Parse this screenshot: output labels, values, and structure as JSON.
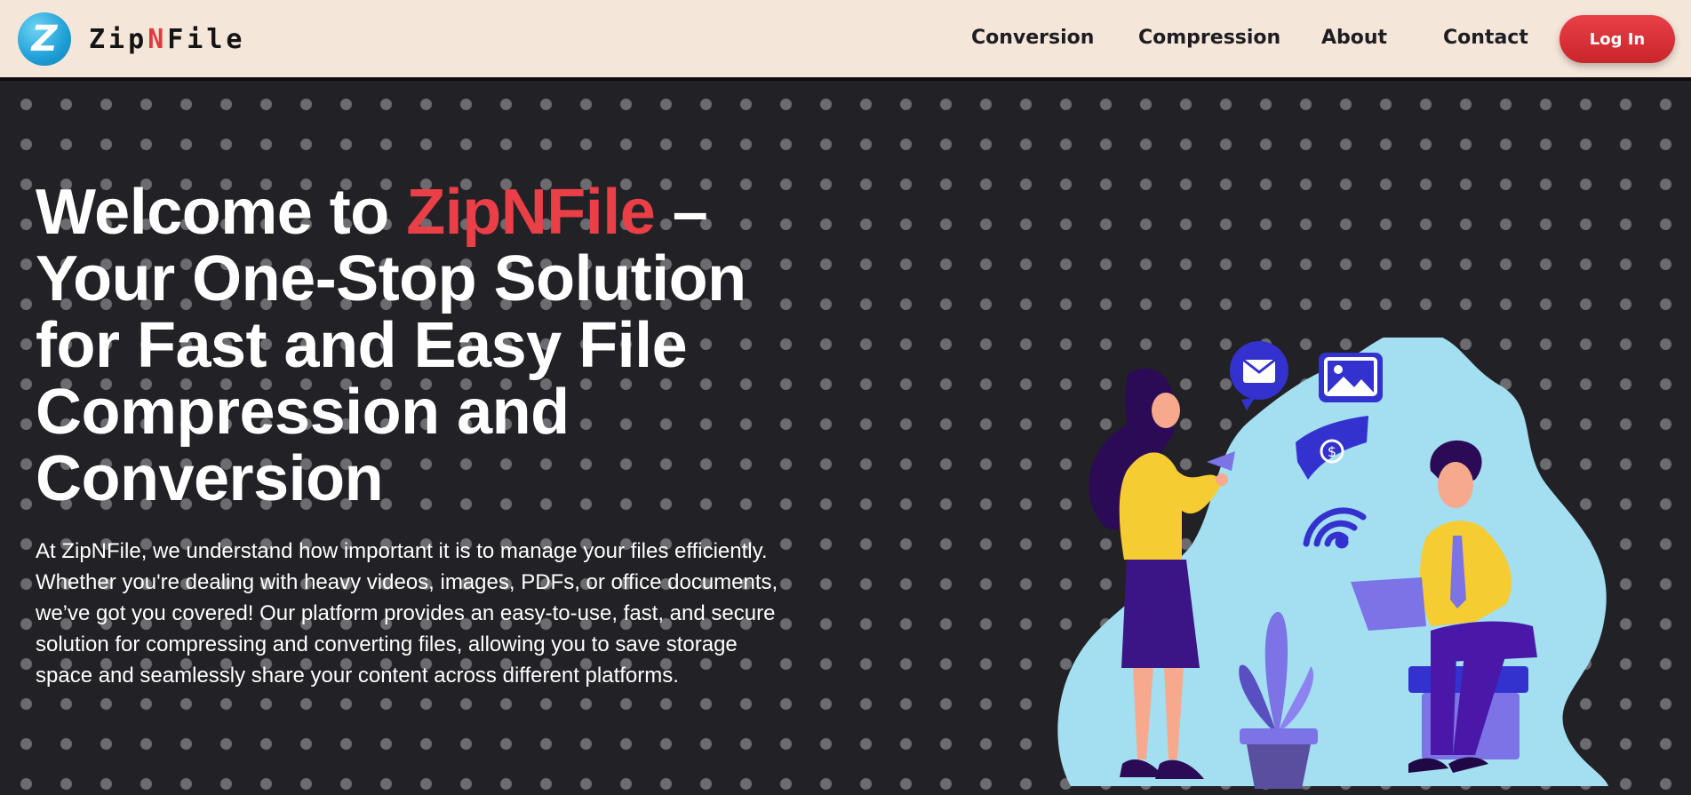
{
  "brand": {
    "badge_letter": "Z",
    "name_prefix": "Zip",
    "name_mid": "N",
    "name_suffix": "File"
  },
  "nav": {
    "items": [
      {
        "label": "Conversion"
      },
      {
        "label": "Compression"
      },
      {
        "label": "About"
      },
      {
        "label": "Contact"
      }
    ],
    "login_label": "Log In"
  },
  "hero": {
    "title_prefix": "Welcome to ",
    "title_brand": "ZipNFile",
    "title_suffix": " – Your One-Stop Solution for Fast and Easy File Compression and Conversion",
    "description": "At ZipNFile, we understand how important it is to manage your files efficiently. Whether you're dealing with heavy videos, images, PDFs, or office documents, we’ve got you covered! Our platform provides an easy-to-use, fast, and secure solution for compressing and converting files, allowing you to save storage space and seamlessly share your content across different platforms."
  },
  "colors": {
    "accent": "#ea3f46",
    "nav_bg": "#f5e6da",
    "hero_bg": "#222226",
    "logo_blue": "#1d9fd6",
    "illustration_blob": "#a3dff0",
    "illustration_icon": "#3432cf"
  },
  "illustration": {
    "icons": [
      "mail-icon",
      "image-icon",
      "money-icon",
      "wifi-icon"
    ]
  }
}
